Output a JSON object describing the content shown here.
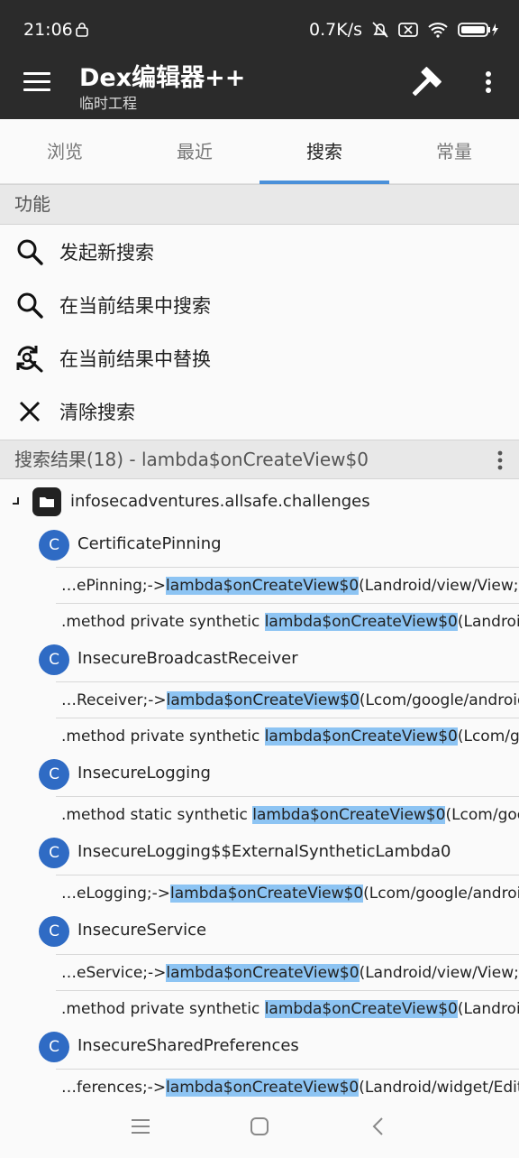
{
  "status_bar": {
    "time": "21:06",
    "speed": "0.7K/s"
  },
  "app_bar": {
    "title": "Dex编辑器++",
    "subtitle": "临时工程",
    "icons": [
      "menu-icon",
      "hammer-icon",
      "more-vert-icon"
    ]
  },
  "tabs": [
    {
      "label": "浏览"
    },
    {
      "label": "最近"
    },
    {
      "label": "搜索"
    },
    {
      "label": "常量"
    }
  ],
  "sections": {
    "functions": "功能",
    "results": "搜索结果(18) - lambda$onCreateView$0"
  },
  "actions": [
    {
      "label": "发起新搜索",
      "icon": "search-icon"
    },
    {
      "label": "在当前结果中搜索",
      "icon": "search-icon"
    },
    {
      "label": "在当前结果中替换",
      "icon": "replace-icon"
    },
    {
      "label": "清除搜索",
      "icon": "close-icon"
    }
  ],
  "tree": {
    "package": "infosecadventures.allsafe.challenges",
    "classes": [
      {
        "badge": "C",
        "name": "CertificatePinning",
        "results": [
          {
            "pre": "…ePinning;->",
            "match": "lambda$onCreateView$0",
            "post": "(Landroid/view/View;)V"
          },
          {
            "pre": ".method private synthetic ",
            "match": "lambda$onCreateView$0",
            "post": "(Landroid/v…"
          }
        ]
      },
      {
        "badge": "C",
        "name": "InsecureBroadcastReceiver",
        "results": [
          {
            "pre": "…Receiver;->",
            "match": "lambda$onCreateView$0",
            "post": "(Lcom/google/android/…"
          },
          {
            "pre": ".method private synthetic ",
            "match": "lambda$onCreateView$0",
            "post": "(Lcom/goo…"
          }
        ]
      },
      {
        "badge": "C",
        "name": "InsecureLogging",
        "results": [
          {
            "pre": ".method static synthetic ",
            "match": "lambda$onCreateView$0",
            "post": "(Lcom/goog…"
          }
        ]
      },
      {
        "badge": "C",
        "name": "InsecureLogging$$ExternalSyntheticLambda0",
        "results": [
          {
            "pre": "…eLogging;->",
            "match": "lambda$onCreateView$0",
            "post": "(Lcom/google/android/…"
          }
        ]
      },
      {
        "badge": "C",
        "name": "InsecureService",
        "results": [
          {
            "pre": "…eService;->",
            "match": "lambda$onCreateView$0",
            "post": "(Landroid/view/View;)V"
          },
          {
            "pre": ".method private synthetic ",
            "match": "lambda$onCreateView$0",
            "post": "(Landroid/v…"
          }
        ]
      },
      {
        "badge": "C",
        "name": "InsecureSharedPreferences",
        "results": [
          {
            "pre": "…ferences;->",
            "match": "lambda$onCreateView$0",
            "post": "(Landroid/widget/EditTe…"
          }
        ]
      }
    ]
  },
  "colors": {
    "app_bar": "#2b2b2b",
    "accent": "#4a90d9",
    "highlight": "#8dc4f3",
    "class_badge": "#2f6bc4"
  }
}
